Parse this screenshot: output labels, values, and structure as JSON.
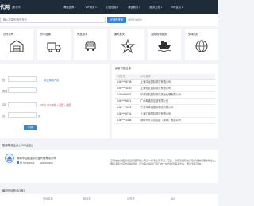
{
  "brand": {
    "name": "代网",
    "sub": "(服务商)"
  },
  "nav": [
    {
      "label": "海运查询",
      "caret": true
    },
    {
      "label": "VIP服务",
      "caret": true
    },
    {
      "label": "订舱信息",
      "caret": true
    },
    {
      "label": "海运服务",
      "caret": true
    },
    {
      "label": "服务文档",
      "caret": true
    },
    {
      "label": "VIP会员",
      "caret": true
    }
  ],
  "search": {
    "placeholder": "输入提单号/箱号查询",
    "button": "IP追踪查询",
    "hint": "推荐查询服务"
  },
  "services": [
    {
      "title": "货代公司",
      "icon": "warehouse-icon"
    },
    {
      "title": "货车运输",
      "icon": "truck-icon"
    },
    {
      "title": "甩挂服务",
      "icon": "trailer-icon"
    },
    {
      "title": "通关报关",
      "icon": "customs-icon"
    },
    {
      "title": "国际物流服务",
      "icon": "ship-icon"
    },
    {
      "title": "全球航线",
      "icon": "globe-icon"
    }
  ],
  "form": {
    "field1": {
      "label": "货",
      "value": "",
      "link": "请选择国产港"
    },
    "field2": {
      "label": "的港",
      "value": ""
    },
    "field3": {
      "label": "CIP",
      "value": "",
      "hint": "CIP价 = FOB价 + 运费 + 保险"
    },
    "field4": {
      "label": "元",
      "value": "",
      "unit": "元"
    },
    "button": "计算"
  },
  "table": {
    "title": "最新订舱信息",
    "headers": [
      "订舱号",
      "公司名称"
    ],
    "rows": [
      [
        "138****8768",
        "上海鸿运国际物流有限公司"
      ],
      [
        "139****3160",
        "上海帕宏国际物流有限公司"
      ],
      [
        "138****6657",
        "宁波锦航国际物流货运代理有限公司"
      ],
      [
        "135****6571",
        "广州邮通供应链有限公司"
      ],
      [
        "138****9029",
        "宁波华泽通国际物流有限公司"
      ],
      [
        "138****5741",
        "上海汇海国际物流有限公司"
      ],
      [
        "136****2346",
        "深圳市东川供应链（深圳）有限公司"
      ]
    ]
  },
  "recommend": {
    "title": "推荐物流企业 (1000企业)",
    "company": "深圳市启航国际货运代理有限公司",
    "phone": "17707993545",
    "qq": "3260153966",
    "description": "深圳市启航国际货运代理有限公司是一家专注于海运、空运、铁路及国际快递等综合物流服务的企业，拥有多年丰富的运输经验，可为客户提供门到门的一站式物流解决方案，服务专业高效。"
  },
  "latest": {
    "title": "最新货运信息(3年)",
    "headers": [
      "货运名称",
      "起运港",
      "目的港",
      "运价"
    ]
  }
}
